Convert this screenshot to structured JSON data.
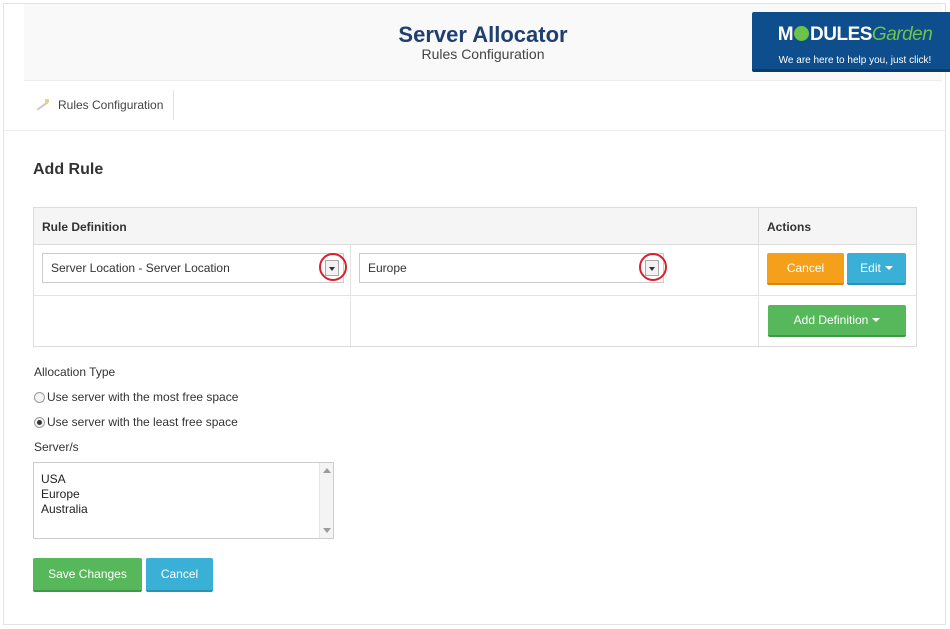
{
  "header": {
    "title": "Server Allocator",
    "subtitle": "Rules Configuration",
    "logo": {
      "text_modules": "M",
      "text_dules": "DULES",
      "text_garden": "Garden",
      "tagline": "We are here to help you, just click!",
      "colors": {
        "background": "#0e4e8c",
        "accent": "#6cc24a"
      }
    }
  },
  "nav": {
    "icon": "magic-wand-icon",
    "label": "Rules Configuration"
  },
  "main": {
    "section_title": "Add Rule",
    "table": {
      "columns": [
        "Rule Definition",
        "Actions"
      ],
      "rows": [
        {
          "definition_select": "Server Location - Server Location",
          "value_select": "Europe",
          "actions": [
            "Cancel",
            "Edit"
          ]
        }
      ],
      "add_definition_label": "Add Definition"
    },
    "allocation": {
      "label": "Allocation Type",
      "options": [
        {
          "label": "Use server with the most free space",
          "checked": false
        },
        {
          "label": "Use server with the least free space",
          "checked": true
        }
      ]
    },
    "servers": {
      "label": "Server/s",
      "items": [
        "USA",
        "Europe",
        "Australia"
      ]
    },
    "buttons": {
      "save": "Save Changes",
      "cancel": "Cancel"
    }
  },
  "colors": {
    "title": "#1f3f6f",
    "orange_button": "#f5a01a",
    "blue_button": "#3bb0d6",
    "green_button": "#56b85a",
    "highlight_ring": "#d8202c"
  }
}
